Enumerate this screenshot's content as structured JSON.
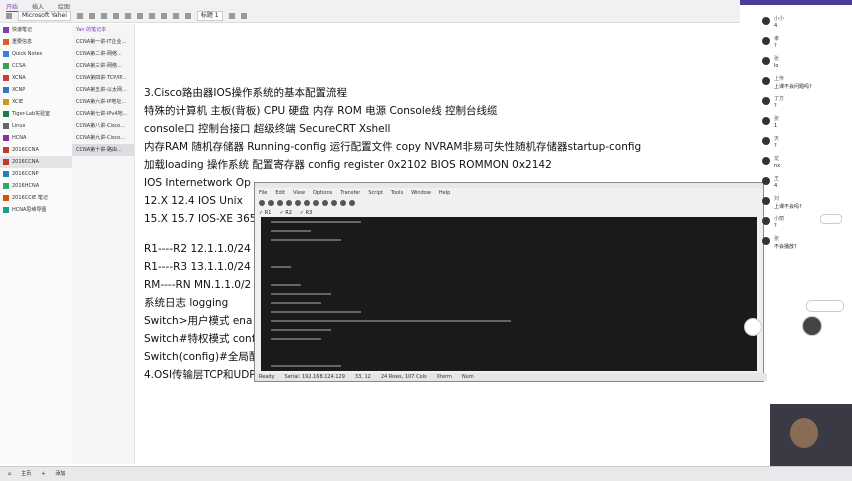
{
  "ribbon": {
    "tabs": [
      "开始",
      "插入",
      "绘图"
    ],
    "font": "Microsoft Yahei",
    "heading": "标题 1"
  },
  "notebooks": [
    {
      "label": "快速笔记",
      "color": "#7b3fb5"
    },
    {
      "label": "重要信息",
      "color": "#e05a2a"
    },
    {
      "label": "Quick Notes",
      "color": "#3a7fd4"
    },
    {
      "label": "CCSA",
      "color": "#3aa04a"
    },
    {
      "label": "XCNA",
      "color": "#d23b3b"
    },
    {
      "label": "XCNP",
      "color": "#2f7bbf"
    },
    {
      "label": "XCIE",
      "color": "#c59a1f"
    },
    {
      "label": "Tiger-Lab实验室",
      "color": "#1f7a4a"
    },
    {
      "label": "Linux",
      "color": "#666666"
    },
    {
      "label": "HCNA",
      "color": "#8b2fa8"
    },
    {
      "label": "2016CCNA",
      "color": "#c0392b"
    },
    {
      "label": "2016CCNA",
      "color": "#c0392b",
      "selected": true
    },
    {
      "label": "2016CCNP",
      "color": "#2980b9"
    },
    {
      "label": "2016HCNA",
      "color": "#27ae60"
    },
    {
      "label": "2016CCIE 笔记",
      "color": "#d35400"
    },
    {
      "label": "HCNA思维导图",
      "color": "#16a085"
    }
  ],
  "sections_header": "Yan 的笔记本",
  "sections": [
    "CCNA第一讲-IT企业...",
    "CCNA第二讲-网络...",
    "CCNA第三讲-网络...",
    "CCNA第四讲-TCP/IP...",
    "CCNA第五讲-以太网...",
    "CCNA第六讲-IP地址...",
    "CCNA第七讲-IPv4地...",
    "CCNA第八讲-Cisco...",
    "CCNA第九讲-Cisco...",
    "CCNA第十讲-路由..."
  ],
  "note_lines": [
    "3.Cisco路由器IOS操作系统的基本配置流程",
    "特殊的计算机  主板(背板) CPU 硬盘 内存 ROM 电源    Console线 控制台线缆",
    "console口 控制台接口 超级终端  SecureCRT  Xshell",
    "内存RAM 随机存储器   Running-config 运行配置文件 copy NVRAM非易可失性随机存储器startup-config",
    "加载loading 操作系统 配置寄存器 config register 0x2102 BIOS ROMMON 0x2142",
    "IOS  Internetwork Op",
    "12.X   12.4 IOS   Unix",
    "15.X   15.7 IOS-XE 365",
    "",
    "R1----R2  12.1.1.0/24",
    "R1----R3  13.1.1.0/24",
    "RM----RN  MN.1.1.0/2",
    "系统日志 logging",
    "Switch>用户模式   ena",
    "Switch#特权模式  conf",
    "Switch(config)#全局配",
    "4.OSI传输层TCP和UDP"
  ],
  "terminal": {
    "menu": [
      "File",
      "Edit",
      "View",
      "Options",
      "Transfer",
      "Script",
      "Tools",
      "Window",
      "Help"
    ],
    "tabs": [
      "✓ R1",
      "✓ R2",
      "✓ R3"
    ],
    "status": [
      "Ready",
      "Serial: 192.168.124.129",
      "33, 12",
      "24 Rows, 107 Cols",
      "Xterm",
      "Num"
    ]
  },
  "chat": {
    "messages": [
      {
        "name": "小小",
        "text": "4"
      },
      {
        "name": "孝",
        "text": "?"
      },
      {
        "name": "张",
        "text": "lo"
      },
      {
        "name": "上传",
        "text": "上课不会问题吗?"
      },
      {
        "name": "丁方",
        "text": "?"
      },
      {
        "name": "张",
        "text": "1"
      },
      {
        "name": "天",
        "text": "?"
      },
      {
        "name": "龙",
        "text": "nx"
      },
      {
        "name": "王",
        "text": "4"
      },
      {
        "name": "刘",
        "text": "上课不会吗?"
      },
      {
        "name": "小丽",
        "text": "?"
      },
      {
        "name": "张",
        "text": "不会播放?"
      }
    ]
  },
  "taskbar": {
    "items": [
      "主页",
      "添加"
    ]
  }
}
